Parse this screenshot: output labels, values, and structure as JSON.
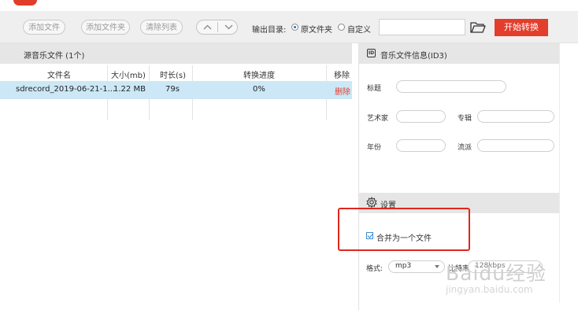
{
  "toolbar": {
    "add_file": "添加文件",
    "add_folder": "添加文件夹",
    "clear_list": "清除列表",
    "output_label": "输出目录:",
    "radio_original": "原文件夹",
    "radio_custom": "自定义",
    "output_path": "",
    "start": "开始转换"
  },
  "source": {
    "title": "源音乐文件 (1个)",
    "columns": [
      "文件名",
      "大小(mb)",
      "时长(s)",
      "转换进度",
      "移除"
    ],
    "rows": [
      {
        "name": "sdrecord_2019-06-21-1...",
        "size": "1.22 MB",
        "duration": "79s",
        "progress": "0%",
        "remove": "删除"
      }
    ]
  },
  "id3": {
    "title": "音乐文件信息(ID3)",
    "icon_text": "ID",
    "title_label": "标题",
    "artist_label": "艺术家",
    "album_label": "专辑",
    "year_label": "年份",
    "genre_label": "流派"
  },
  "settings": {
    "title": "设置",
    "merge_label": "合并为一个文件",
    "merge_checked": true,
    "format_label": "格式:",
    "format_value": "mp3",
    "bitrate_label": "比特率:",
    "bitrate_value": "128kbps"
  },
  "watermark": {
    "main": "Baidu经验",
    "sub": "jingyan.baidu.com"
  },
  "colors": {
    "accent_red": "#e33d2c",
    "selected_row": "#cce8f6",
    "highlight_box": "#e0271c"
  }
}
